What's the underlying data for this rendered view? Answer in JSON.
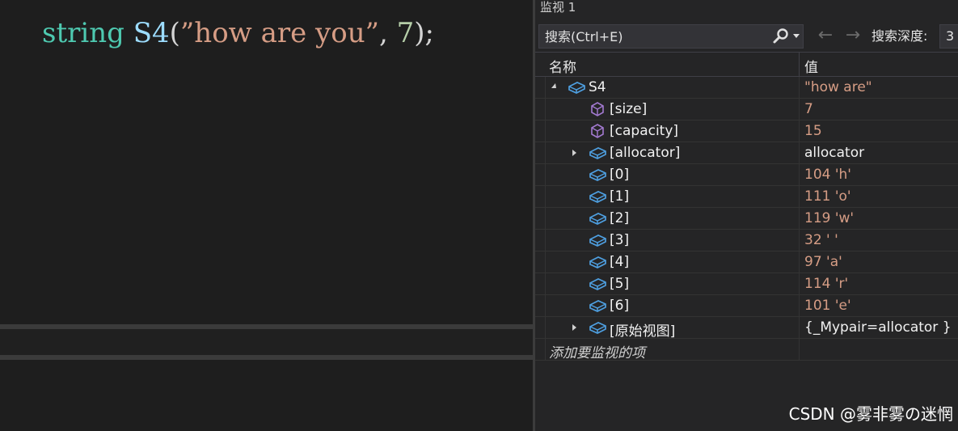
{
  "editor": {
    "code": {
      "type": "string",
      "space": " ",
      "var": "S4",
      "open": "(",
      "str": "”how are you”",
      "comma": ", ",
      "num": "7",
      "close": ");"
    }
  },
  "watch": {
    "title": "监视 1",
    "search_placeholder": "搜索(Ctrl+E)",
    "depth_label": "搜索深度:",
    "depth_value": "3",
    "columns": {
      "name": "名称",
      "value": "值"
    },
    "rows": [
      {
        "name": "S4",
        "value": "\"how are\"",
        "icon": "class-object-icon",
        "expander": "expanded"
      },
      {
        "name": "[size]",
        "value": "7",
        "icon": "property-icon",
        "expander": "none"
      },
      {
        "name": "[capacity]",
        "value": "15",
        "icon": "property-icon",
        "expander": "none"
      },
      {
        "name": "[allocator]",
        "value": "allocator",
        "icon": "class-object-icon",
        "expander": "collapsed"
      },
      {
        "name": "[0]",
        "value": "104 'h'",
        "icon": "class-object-icon",
        "expander": "none"
      },
      {
        "name": "[1]",
        "value": "111 'o'",
        "icon": "class-object-icon",
        "expander": "none"
      },
      {
        "name": "[2]",
        "value": "119 'w'",
        "icon": "class-object-icon",
        "expander": "none"
      },
      {
        "name": "[3]",
        "value": "32 ' '",
        "icon": "class-object-icon",
        "expander": "none"
      },
      {
        "name": "[4]",
        "value": "97 'a'",
        "icon": "class-object-icon",
        "expander": "none"
      },
      {
        "name": "[5]",
        "value": "114 'r'",
        "icon": "class-object-icon",
        "expander": "none"
      },
      {
        "name": "[6]",
        "value": "101 'e'",
        "icon": "class-object-icon",
        "expander": "none"
      },
      {
        "name": "[原始视图]",
        "value": "{_Mypair=allocator }",
        "icon": "class-object-icon",
        "expander": "collapsed"
      }
    ],
    "add_item": "添加要监视的项"
  },
  "watermark": "CSDN @雾非雾の迷惘",
  "colors": {
    "string_value": "#d69d85",
    "type_keyword": "#4ec9b0",
    "variable": "#9cdcfe",
    "object_icon": "#4e9fe0",
    "property_icon": "#a37ad1"
  }
}
